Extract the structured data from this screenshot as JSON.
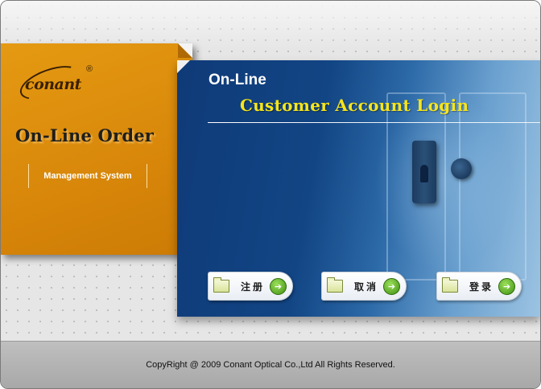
{
  "brand": {
    "logo_text": "conant",
    "registered_mark": "®",
    "order_title": "On-Line Order",
    "subtitle": "Management System"
  },
  "login_panel": {
    "heading": "On-Line",
    "title": "Customer Account Login"
  },
  "buttons": {
    "register_label": "注册",
    "cancel_label": "取消",
    "login_label": "登录",
    "arrow_glyph": "➔"
  },
  "footer": {
    "copyright": "CopyRight @ 2009 Conant Optical Co.,Ltd All Rights Reserved."
  },
  "colors": {
    "accent_orange": "#dd8e0c",
    "panel_blue": "#124584",
    "title_yellow": "#f6e51a"
  },
  "icons": [
    "folder-icon",
    "arrow-right-icon",
    "logo-swoosh"
  ]
}
